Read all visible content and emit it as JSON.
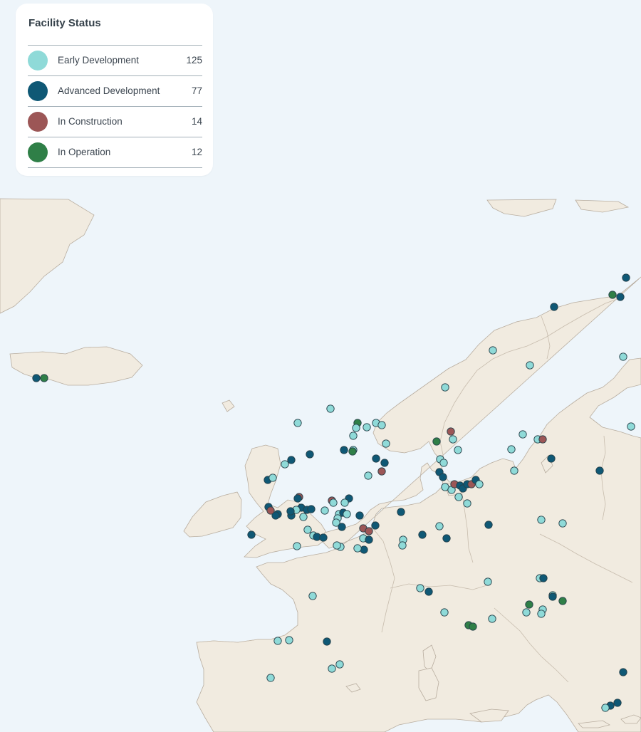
{
  "legend": {
    "title": "Facility Status",
    "items": [
      {
        "label": "Early Development",
        "count": "125",
        "color": "#8fdad8"
      },
      {
        "label": "Advanced Development",
        "count": "77",
        "color": "#0f5875"
      },
      {
        "label": "In Construction",
        "count": "14",
        "color": "#9c5656"
      },
      {
        "label": "In Operation",
        "count": "12",
        "color": "#2f7f47"
      }
    ]
  },
  "map": {
    "sea_color": "#eef5fa",
    "land_color": "#f1ebe0",
    "marker_statuses": [
      "early-development",
      "advanced-development",
      "in-construction",
      "in-operation"
    ]
  }
}
